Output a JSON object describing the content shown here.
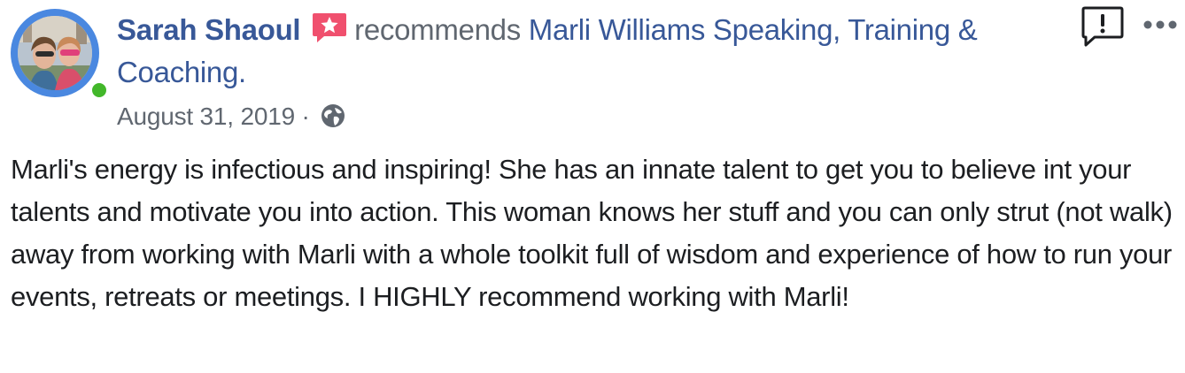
{
  "post": {
    "author_name": "Sarah Shaoul",
    "action_text": "recommends",
    "page_name": "Marli Williams Speaking, Training & Coaching.",
    "date": "August 31, 2019",
    "separator": "·",
    "privacy_icon": "globe-icon",
    "badge_icon": "recommendation-star-icon",
    "online_status": "online",
    "report_icon": "report-exclamation-icon",
    "more_icon": "more-options-icon",
    "review_text": "Marli's energy is infectious and inspiring! She has an innate talent to get you to believe int your talents and motivate you into action. This woman knows her stuff and you can only strut (not walk) away from working with Marli with a whole toolkit full of wisdom and experience of how to run your events, retreats or meetings. I HIGHLY recommend working with Marli!"
  },
  "colors": {
    "link_blue": "#385898",
    "secondary_text": "#606770",
    "body_text": "#1c1e21",
    "badge_red": "#f0506e",
    "online_green": "#42b72a",
    "avatar_ring": "#4a88e0"
  }
}
